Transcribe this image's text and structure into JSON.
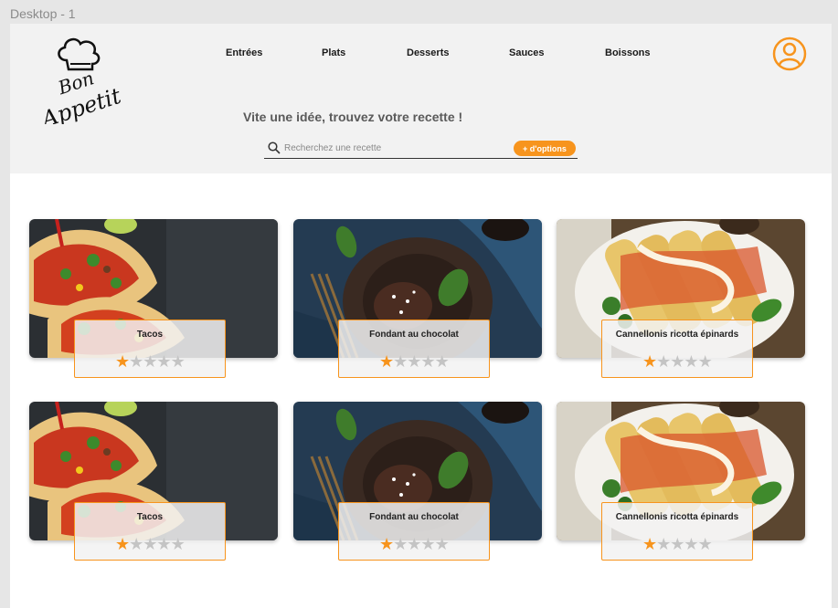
{
  "frame_label": "Desktop - 1",
  "brand": {
    "logo_text_1": "Bon",
    "logo_text_2": "Appetit"
  },
  "nav": [
    {
      "label": "Entrées"
    },
    {
      "label": "Plats"
    },
    {
      "label": "Desserts"
    },
    {
      "label": "Sauces"
    },
    {
      "label": "Boissons"
    }
  ],
  "tagline": "Vite une idée, trouvez votre recette !",
  "search": {
    "placeholder": "Recherchez une recette",
    "options_label": "+ d'options"
  },
  "colors": {
    "accent": "#f7941d",
    "header_bg": "#f2f2f2"
  },
  "recipes": [
    {
      "title": "Tacos",
      "rating": 1,
      "max": 5,
      "image": "tacos"
    },
    {
      "title": "Fondant au chocolat",
      "rating": 1,
      "max": 5,
      "image": "chocolate-fondant"
    },
    {
      "title": "Cannellonis ricotta épinards",
      "rating": 1,
      "max": 5,
      "image": "cannelloni"
    },
    {
      "title": "Tacos",
      "rating": 1,
      "max": 5,
      "image": "tacos"
    },
    {
      "title": "Fondant au chocolat",
      "rating": 1,
      "max": 5,
      "image": "chocolate-fondant"
    },
    {
      "title": "Cannellonis ricotta épinards",
      "rating": 1,
      "max": 5,
      "image": "cannelloni"
    }
  ]
}
